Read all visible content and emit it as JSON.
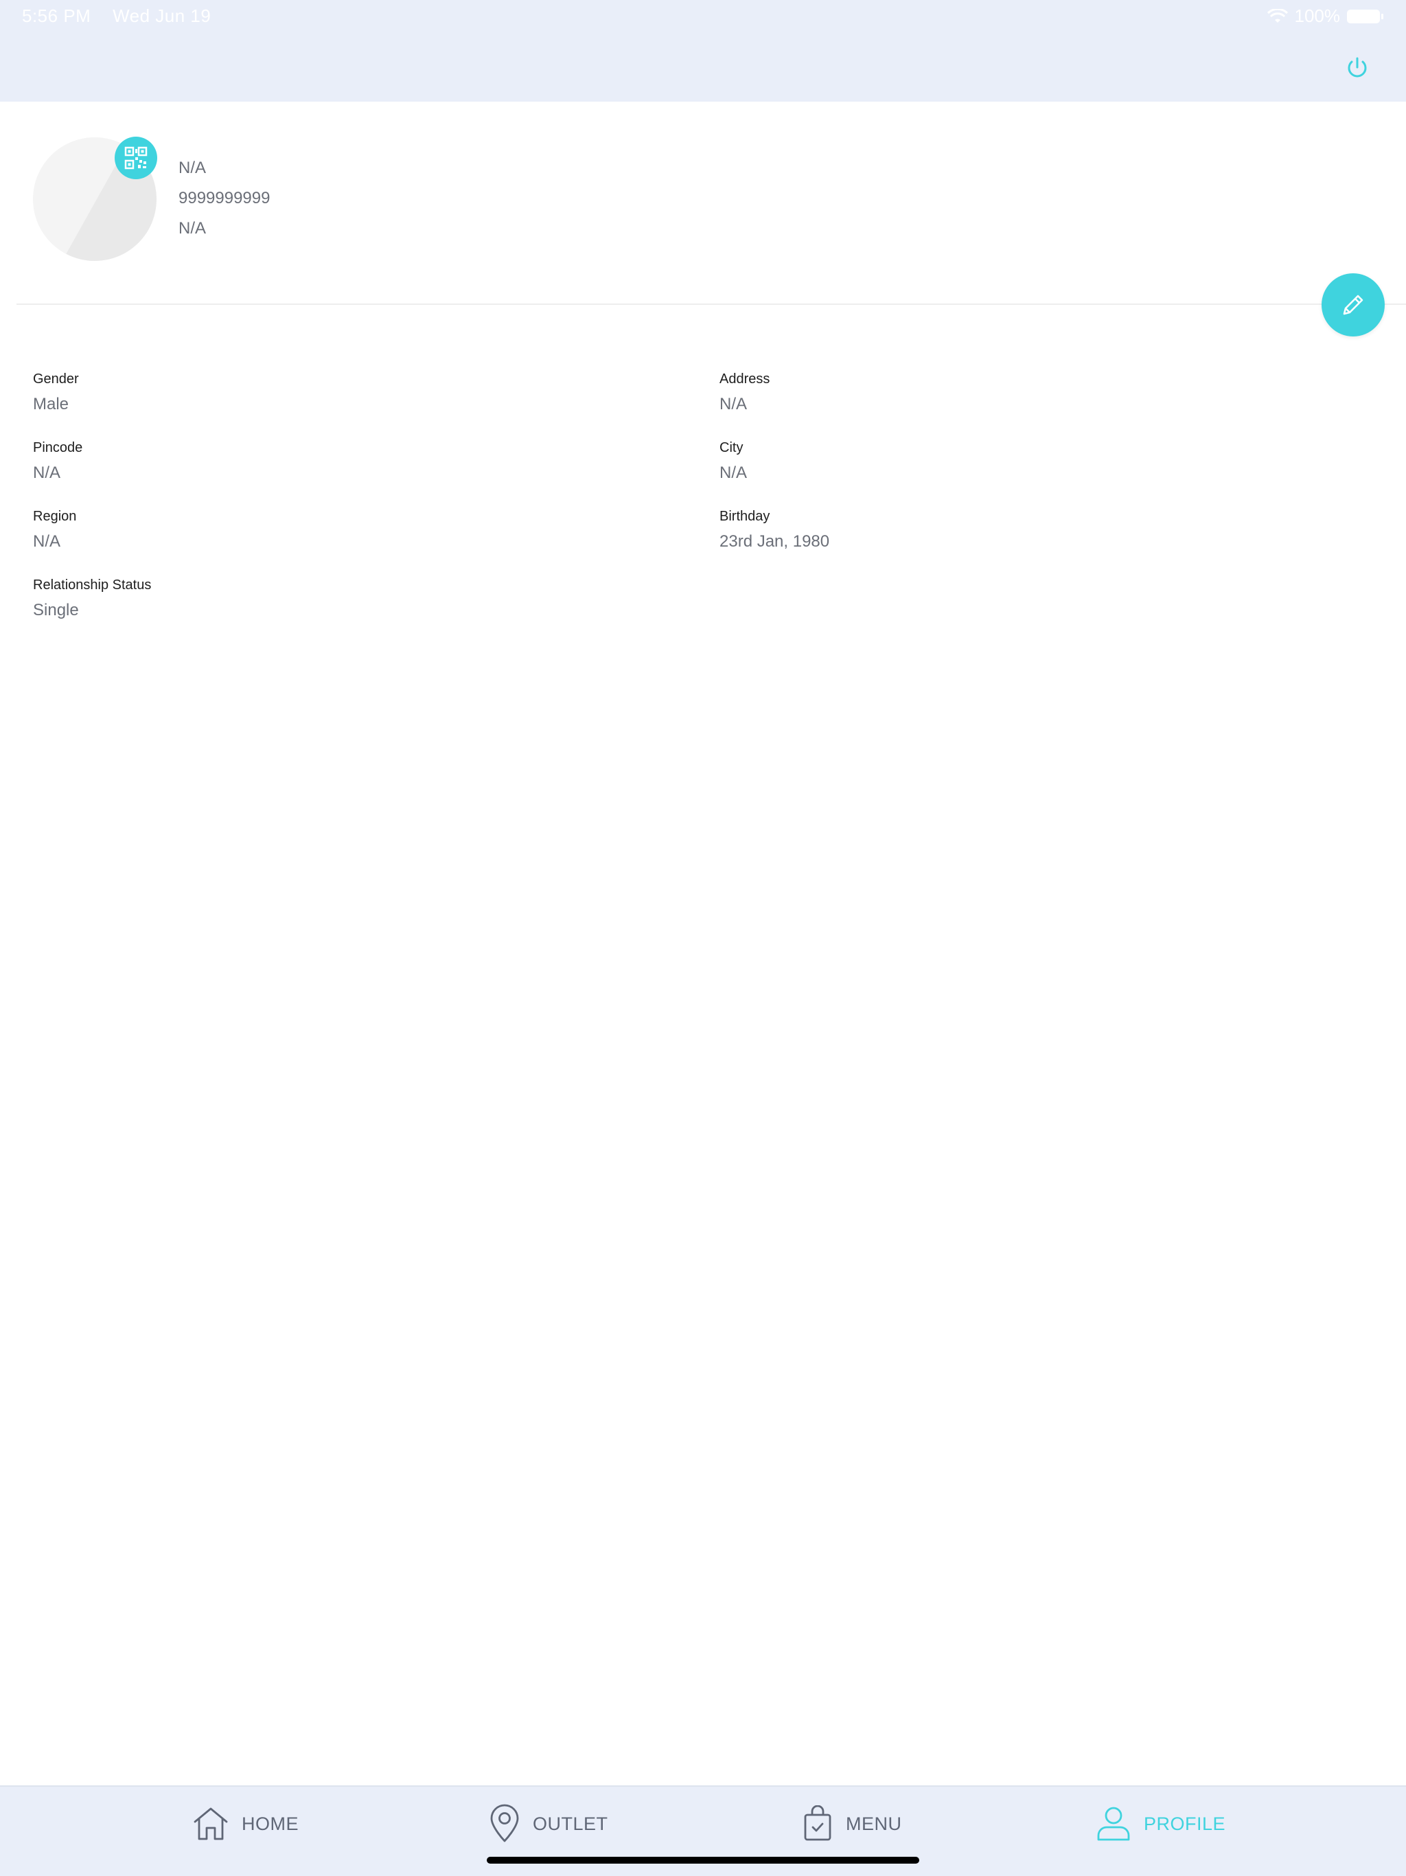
{
  "status_bar": {
    "time": "5:56 PM",
    "date": "Wed Jun 19",
    "battery": "100%"
  },
  "profile": {
    "name": "N/A",
    "phone": "9999999999",
    "email": "N/A"
  },
  "fields": [
    {
      "label": "Gender",
      "value": "Male"
    },
    {
      "label": "Address",
      "value": "N/A"
    },
    {
      "label": "Pincode",
      "value": "N/A"
    },
    {
      "label": "City",
      "value": "N/A"
    },
    {
      "label": "Region",
      "value": "N/A"
    },
    {
      "label": "Birthday",
      "value": "23rd Jan, 1980"
    },
    {
      "label": "Relationship Status",
      "value": "Single"
    }
  ],
  "nav": {
    "items": [
      {
        "label": "HOME",
        "icon": "home-icon"
      },
      {
        "label": "OUTLET",
        "icon": "location-pin-icon"
      },
      {
        "label": "MENU",
        "icon": "shopping-bag-icon"
      },
      {
        "label": "PROFILE",
        "icon": "user-icon"
      }
    ],
    "active": "PROFILE"
  },
  "colors": {
    "accent": "#3fd3de",
    "header_bg": "#e9eef9",
    "muted_text": "#6b6f78"
  }
}
